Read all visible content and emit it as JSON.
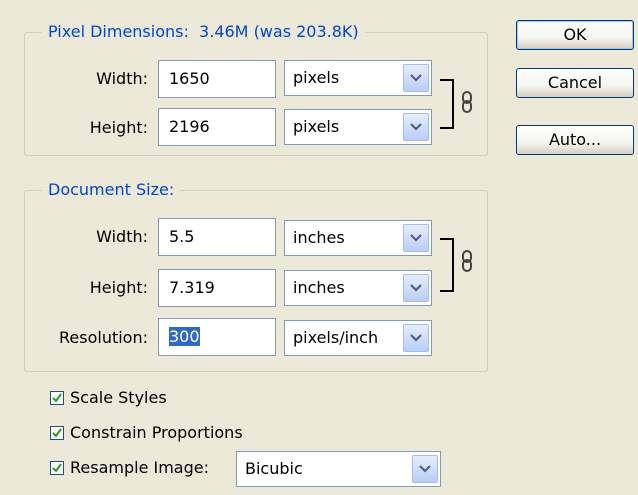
{
  "pixel_dimensions": {
    "legend": "Pixel Dimensions:",
    "size_info": "3.46M (was 203.8K)",
    "width_label": "Width:",
    "width_value": "1650",
    "width_unit": "pixels",
    "height_label": "Height:",
    "height_value": "2196",
    "height_unit": "pixels"
  },
  "document_size": {
    "legend": "Document Size:",
    "width_label": "Width:",
    "width_value": "5.5",
    "width_unit": "inches",
    "height_label": "Height:",
    "height_value": "7.319",
    "height_unit": "inches",
    "resolution_label": "Resolution:",
    "resolution_value": "300",
    "resolution_unit": "pixels/inch"
  },
  "options": {
    "scale_styles_label": "Scale Styles",
    "scale_styles_checked": true,
    "constrain_label": "Constrain Proportions",
    "constrain_checked": true,
    "resample_label": "Resample Image:",
    "resample_checked": true,
    "resample_method": "Bicubic"
  },
  "buttons": {
    "ok": "OK",
    "cancel": "Cancel",
    "auto": "Auto..."
  },
  "colors": {
    "dialog_bg": "#ece9d8",
    "legend_text": "#0046d5",
    "selection_bg": "#316ac5",
    "check_mark": "#21a121"
  }
}
